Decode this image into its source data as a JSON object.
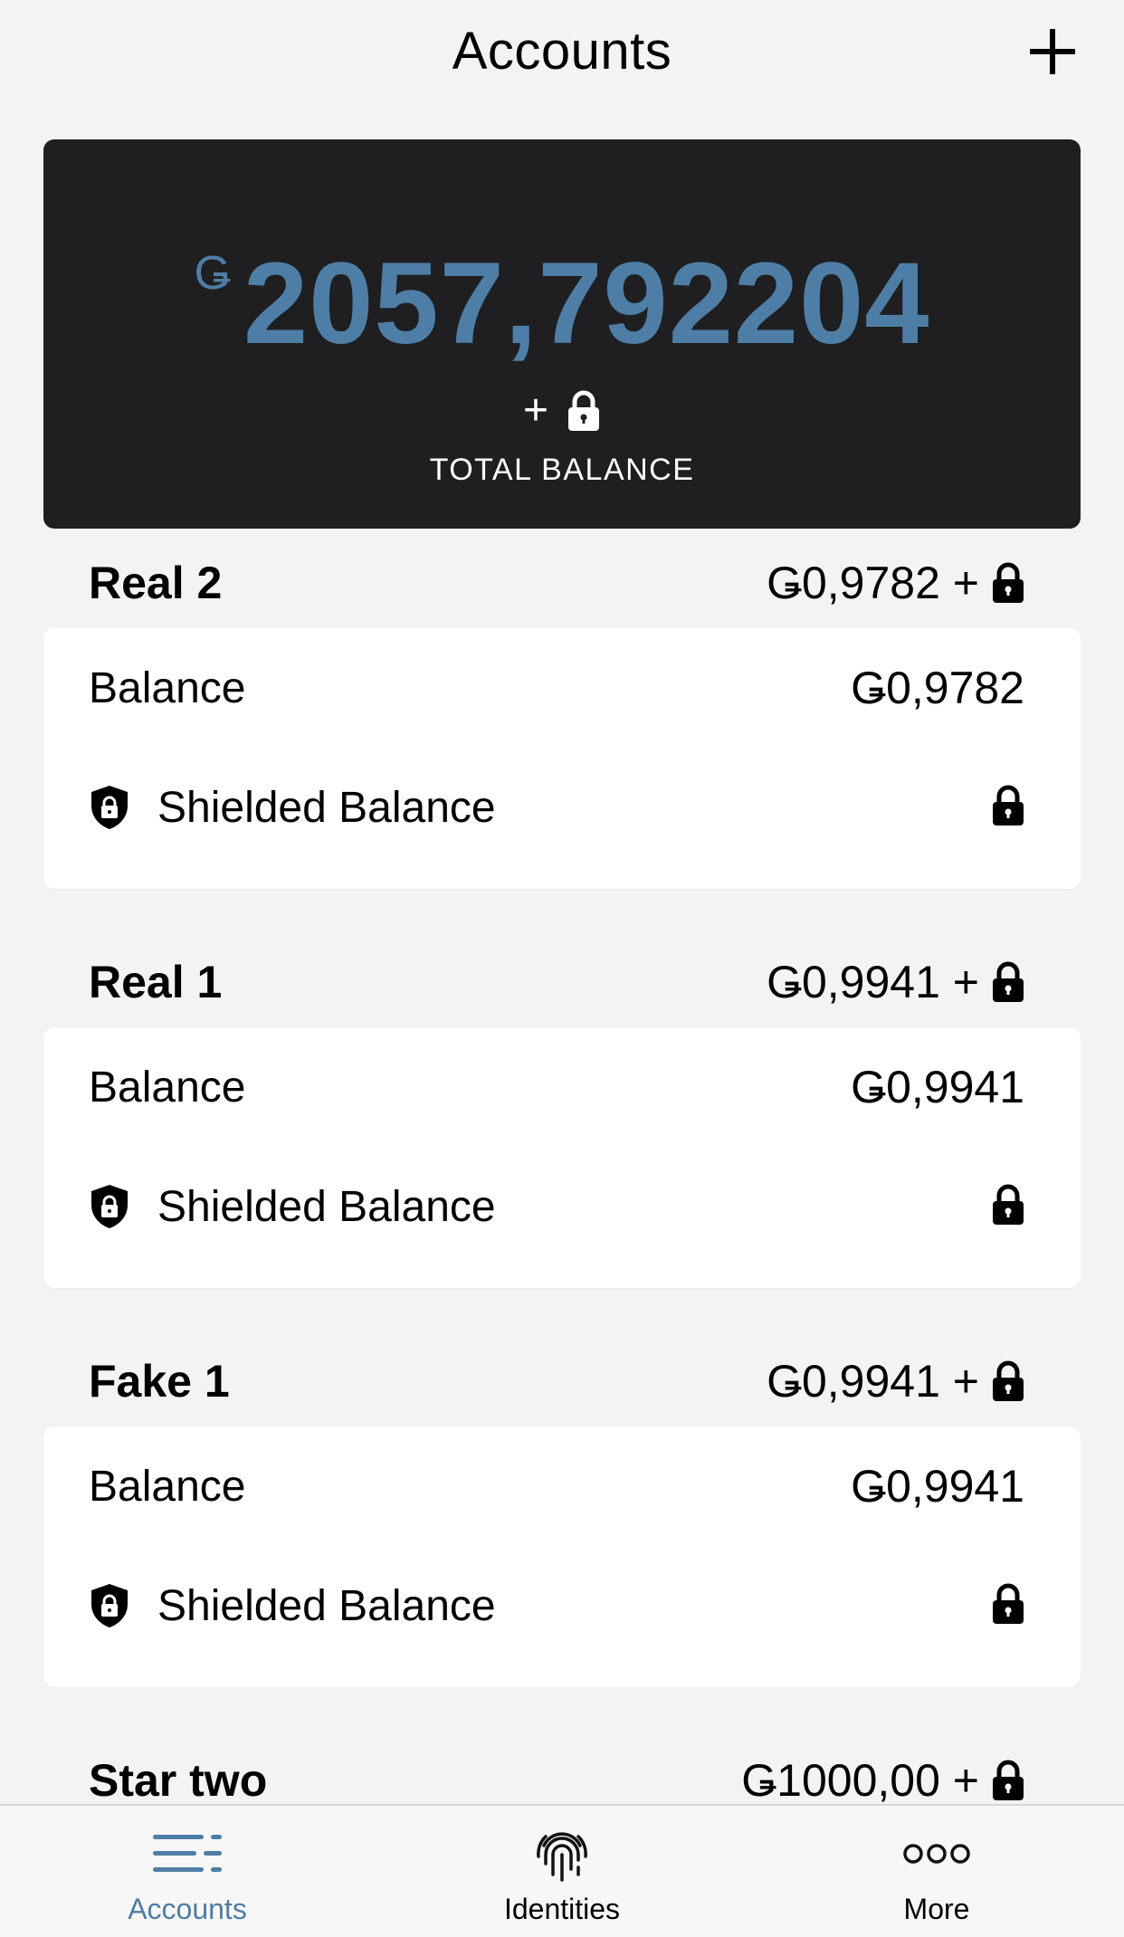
{
  "header": {
    "title": "Accounts",
    "add_icon": "plus-icon"
  },
  "total": {
    "currency_symbol": "Ǥ",
    "amount": "2057,792204",
    "plus": "+",
    "label": "TOTAL BALANCE",
    "accent_color": "#4e7ea6"
  },
  "accounts": [
    {
      "name": "Real 2",
      "header_amount": "Ǥ0,9782 +",
      "balance_label": "Balance",
      "balance_value": "Ǥ0,9782",
      "shielded_label": "Shielded Balance"
    },
    {
      "name": "Real 1",
      "header_amount": "Ǥ0,9941 +",
      "balance_label": "Balance",
      "balance_value": "Ǥ0,9941",
      "shielded_label": "Shielded Balance"
    },
    {
      "name": "Fake 1",
      "header_amount": "Ǥ0,9941 +",
      "balance_label": "Balance",
      "balance_value": "Ǥ0,9941",
      "shielded_label": "Shielded Balance"
    },
    {
      "name": "Star two",
      "header_amount": "Ǥ1000,00 +"
    }
  ],
  "nav": {
    "items": [
      {
        "label": "Accounts",
        "icon": "accounts-list-icon",
        "active": true
      },
      {
        "label": "Identities",
        "icon": "fingerprint-icon",
        "active": false
      },
      {
        "label": "More",
        "icon": "more-dots-icon",
        "active": false
      }
    ]
  }
}
